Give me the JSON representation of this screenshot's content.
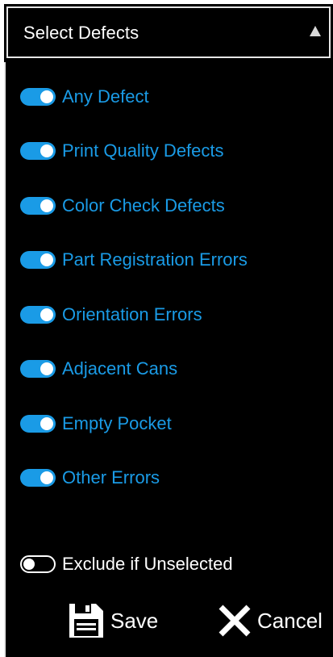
{
  "header": {
    "title": "Select Defects",
    "arrow_icon": "triangle-up-icon"
  },
  "accent_color": "#1a9be6",
  "defects": [
    {
      "label": "Any Defect",
      "on": true
    },
    {
      "label": "Print Quality Defects",
      "on": true
    },
    {
      "label": "Color Check Defects",
      "on": true
    },
    {
      "label": "Part Registration Errors",
      "on": true
    },
    {
      "label": "Orientation Errors",
      "on": true
    },
    {
      "label": "Adjacent Cans",
      "on": true
    },
    {
      "label": "Empty Pocket",
      "on": true
    },
    {
      "label": "Other Errors",
      "on": true
    }
  ],
  "exclude": {
    "label": "Exclude if Unselected",
    "on": false
  },
  "actions": {
    "save_label": "Save",
    "save_icon": "floppy-disk-icon",
    "cancel_label": "Cancel",
    "cancel_icon": "x-close-icon"
  }
}
